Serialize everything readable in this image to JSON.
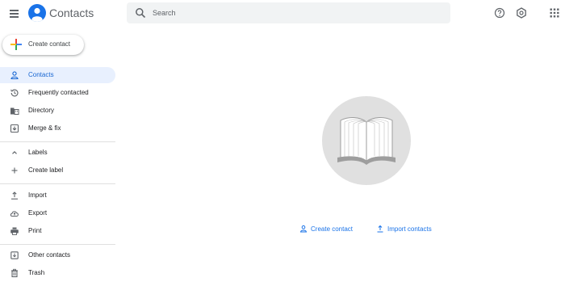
{
  "app": {
    "title": "Contacts"
  },
  "search": {
    "placeholder": "Search"
  },
  "header": {
    "icons": [
      "help-icon",
      "settings-icon",
      "apps-grid-icon"
    ]
  },
  "sidebar": {
    "create_label": "Create contact",
    "items": [
      {
        "label": "Contacts",
        "icon": "person-icon",
        "active": true
      },
      {
        "label": "Frequently contacted",
        "icon": "history-icon"
      },
      {
        "label": "Directory",
        "icon": "directory-icon"
      },
      {
        "label": "Merge & fix",
        "icon": "merge-icon"
      },
      {
        "label": "Labels",
        "icon": "chevron-up-icon"
      },
      {
        "label": "Create label",
        "icon": "plus-icon"
      },
      {
        "label": "Import",
        "icon": "upload-icon"
      },
      {
        "label": "Export",
        "icon": "cloud-icon"
      },
      {
        "label": "Print",
        "icon": "print-icon"
      },
      {
        "label": "Other contacts",
        "icon": "archive-icon"
      },
      {
        "label": "Trash",
        "icon": "trash-icon"
      }
    ]
  },
  "main": {
    "actions": [
      {
        "label": "Create contact",
        "icon": "person-outline-icon"
      },
      {
        "label": "Import contacts",
        "icon": "upload-icon"
      }
    ]
  },
  "colors": {
    "accent": "#1a73e8",
    "active_bg": "#e8f0fe",
    "search_bg": "#f1f3f4"
  }
}
